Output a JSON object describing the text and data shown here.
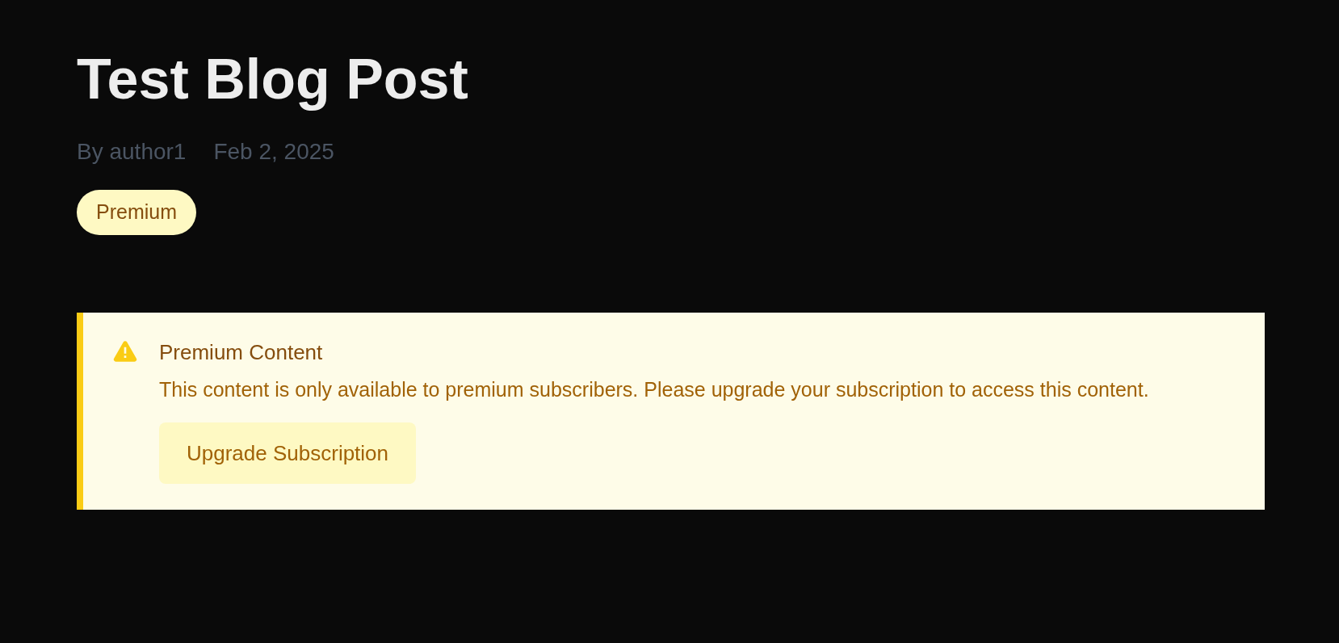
{
  "post": {
    "title": "Test Blog Post",
    "author": "By author1",
    "date": "Feb 2, 2025",
    "badge": "Premium"
  },
  "notice": {
    "title": "Premium Content",
    "message": "This content is only available to premium subscribers. Please upgrade your subscription to access this content.",
    "button": "Upgrade Subscription"
  }
}
